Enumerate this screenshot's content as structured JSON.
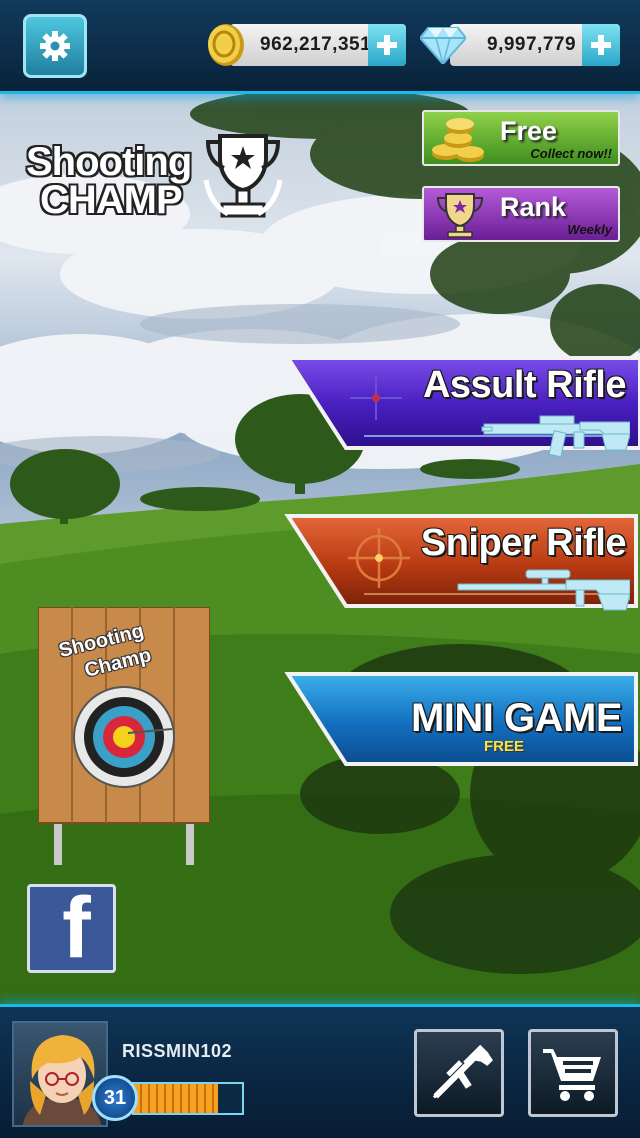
{
  "currency": {
    "coins": "962,217,351",
    "gems": "9,997,779"
  },
  "logo": {
    "line1": "Shooting",
    "line2": "CHAMP"
  },
  "free_button": {
    "title": "Free",
    "subtitle": "Collect now!!"
  },
  "rank_button": {
    "title": "Rank",
    "subtitle": "Weekly"
  },
  "modes": {
    "assault": "Assult Rifle",
    "sniper": "Sniper Rifle",
    "mini_game": "MINI GAME",
    "mini_game_tag": "FREE"
  },
  "target_board": {
    "title_line1": "Shooting",
    "title_line2": "Champ"
  },
  "social": {
    "facebook_label": "f"
  },
  "player": {
    "name": "RISSMIN102",
    "level": "31",
    "xp_fraction": 0.78
  },
  "colors": {
    "accent": "#1fb6e8",
    "free_green": "#5fb52e",
    "rank_purple": "#8a35b5",
    "assault_purple": "#5a2ad0",
    "sniper_orange": "#d2501a",
    "mini_blue": "#1a7fc8",
    "facebook_blue": "#3b5998"
  },
  "icons": [
    "settings-gear-icon",
    "coin-icon",
    "gem-icon",
    "plus-icon",
    "trophy-icon",
    "crosshair-icon",
    "rifle-icon",
    "sniper-rifle-icon",
    "target-icon",
    "facebook-icon",
    "shopping-cart-icon"
  ]
}
